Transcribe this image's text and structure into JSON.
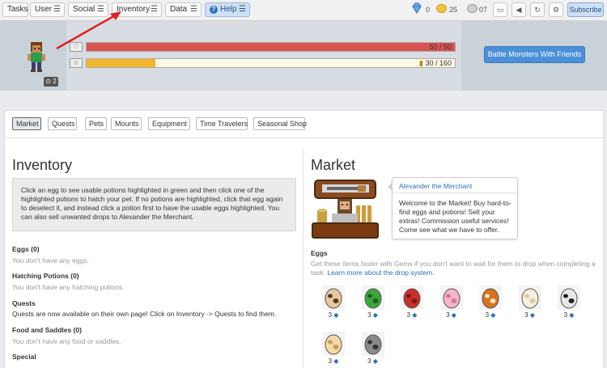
{
  "nav": {
    "items": [
      {
        "label": "Tasks"
      },
      {
        "label": "User"
      },
      {
        "label": "Social"
      },
      {
        "label": "Inventory"
      },
      {
        "label": "Data"
      },
      {
        "label": "Help"
      }
    ],
    "menu_glyph": "☰",
    "gems": "0",
    "gold": "25",
    "silver": "07",
    "subscribe_label": "Subscribe"
  },
  "header": {
    "health_text": "50 / 50",
    "health_fraction": 1.0,
    "exp_text": "30 / 160",
    "exp_fraction": 0.1875,
    "level_badge": "2",
    "battle_button": "Battle Monsters With Friends",
    "colors": {
      "health": "#d9534f",
      "exp": "#f4b62c"
    }
  },
  "tabs": [
    {
      "label": "Market",
      "active": true
    },
    {
      "label": "Quests"
    },
    {
      "label": "Pets"
    },
    {
      "label": "Mounts"
    },
    {
      "label": "Equipment"
    },
    {
      "label": "Time Travelers"
    },
    {
      "label": "Seasonal Shop"
    }
  ],
  "inventory": {
    "title": "Inventory",
    "info": "Click an egg to see usable potions highlighted in green and then click one of the highlighted potions to hatch your pet. If no potions are highlighted, click that egg again to deselect it, and instead click a potion first to have the usable eggs highlighted. You can also sell unwanted drops to Alexander the Merchant.",
    "sections": [
      {
        "title": "Eggs (0)",
        "text": "You don't have any eggs."
      },
      {
        "title": "Hatching Potions (0)",
        "text": "You don't have any hatching potions."
      },
      {
        "title": "Quests",
        "text": "Quests are now available on their own page! Click on Inventory -> Quests to find them."
      },
      {
        "title": "Food and Saddles (0)",
        "text": "You don't have any food or saddles."
      },
      {
        "title": "Special",
        "text": ""
      }
    ]
  },
  "market": {
    "title": "Market",
    "merchant_name": "Alexander the Merchant",
    "merchant_msg": "Welcome to the Market! Buy hard-to-find eggs and potions! Sell your extras! Commission useful services! Come see what we have to offer.",
    "eggs_title": "Eggs",
    "eggs_desc": "Get these items faster with Gems if you don't want to wait for them to drop when completing a task. ",
    "eggs_link": "Learn more about the drop system.",
    "eggs": [
      {
        "name": "wolf-egg",
        "price": "3",
        "color": "#e8c9a0",
        "spot": "#5a3b1f"
      },
      {
        "name": "turtle-egg",
        "price": "3",
        "color": "#3aa73a",
        "spot": "#1e5f1e"
      },
      {
        "name": "dragon-egg",
        "price": "3",
        "color": "#c9302c",
        "spot": "#7a1a17"
      },
      {
        "name": "pig-egg",
        "price": "3",
        "color": "#f4b6c8",
        "spot": "#d07a92"
      },
      {
        "name": "fox-egg",
        "price": "3",
        "color": "#d9721f",
        "spot": "#f5e6c8"
      },
      {
        "name": "bunny-egg",
        "price": "3",
        "color": "#f5efe0",
        "spot": "#e0c89a"
      },
      {
        "name": "cat-egg",
        "price": "3",
        "color": "#e8e8e8",
        "spot": "#222222"
      },
      {
        "name": "lion-egg",
        "price": "3",
        "color": "#f2d9a8",
        "spot": "#c99a55"
      },
      {
        "name": "bear-egg",
        "price": "3",
        "color": "#8a8a8a",
        "spot": "#333333"
      }
    ]
  }
}
